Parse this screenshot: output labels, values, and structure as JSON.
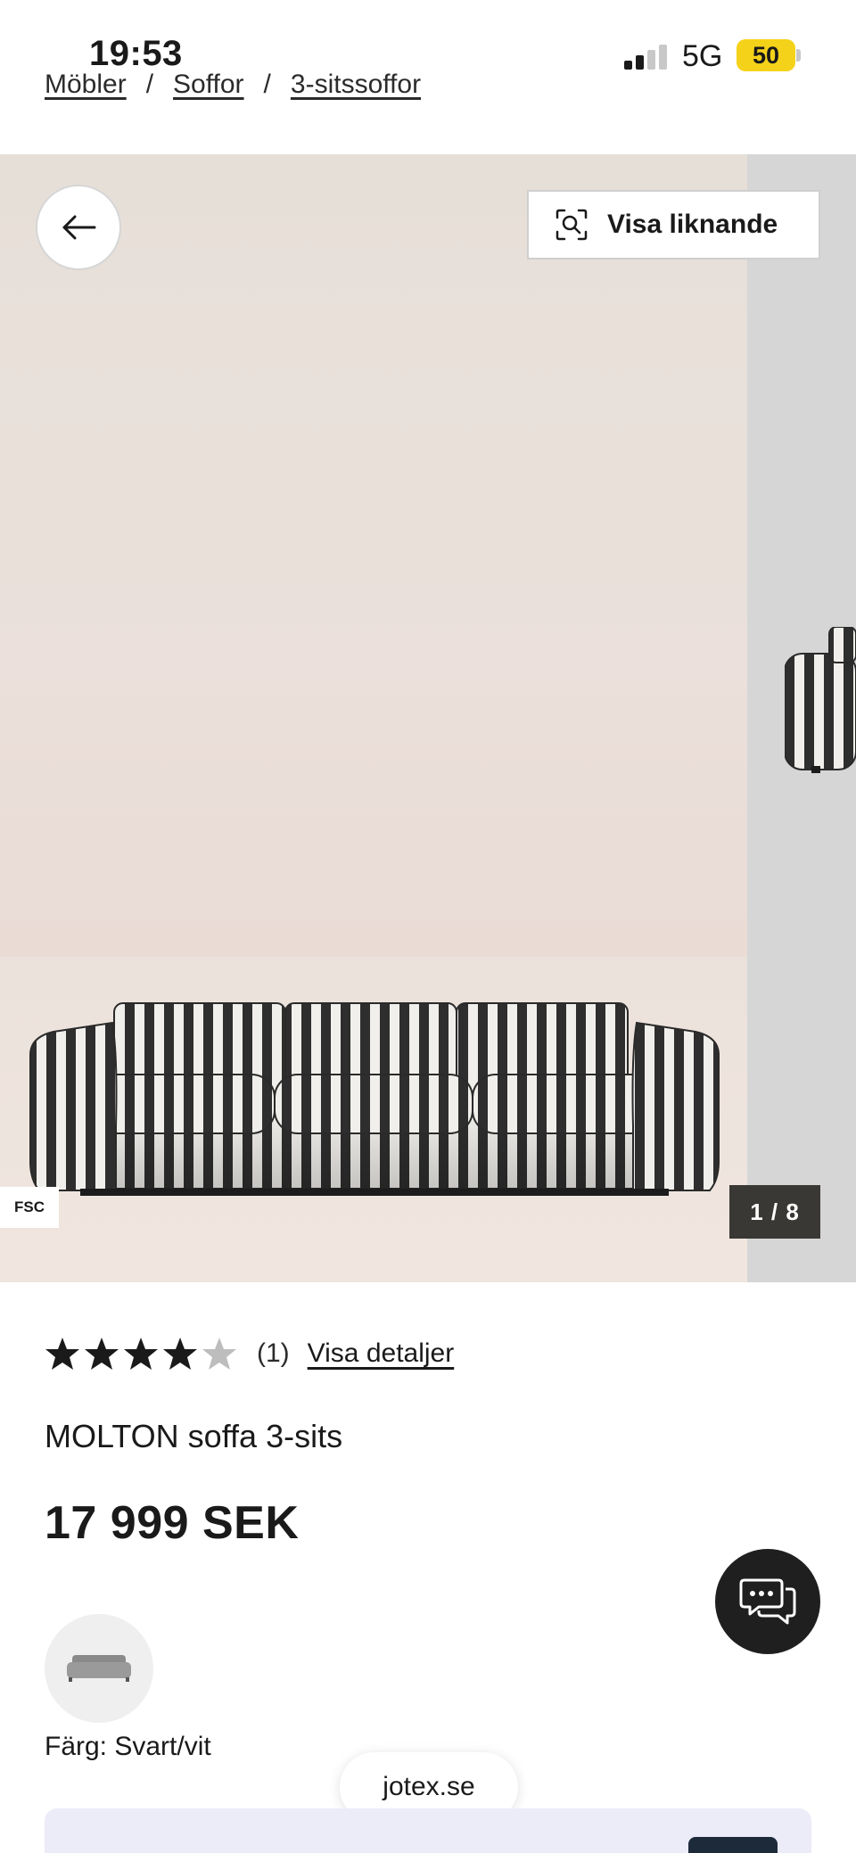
{
  "status_bar": {
    "time": "19:53",
    "network": "5G",
    "battery": "50"
  },
  "breadcrumb": {
    "items": [
      "Möbler",
      "Soffor",
      "3-sitssoffor"
    ],
    "separator": "/"
  },
  "gallery": {
    "similar_label": "Visa liknande",
    "badge": "FSC",
    "counter": "1 / 8",
    "current_index": 1,
    "total": 8
  },
  "product": {
    "rating": 4,
    "rating_max": 5,
    "review_count": "(1)",
    "details_link": "Visa detaljer",
    "name": "MOLTON soffa 3-sits",
    "price": "17 999 SEK",
    "color_label": "Färg: Svart/vit"
  },
  "footer": {
    "site": "jotex.se"
  },
  "icons": [
    "back-arrow-icon",
    "visual-search-icon",
    "star-icon",
    "chat-icon"
  ],
  "colors": {
    "star_filled": "#1a1a1a",
    "star_empty": "#bdbdbd",
    "counter_bg": "#3a3835",
    "battery": "#f5d21a",
    "chat_bg": "#1f1f1f"
  }
}
